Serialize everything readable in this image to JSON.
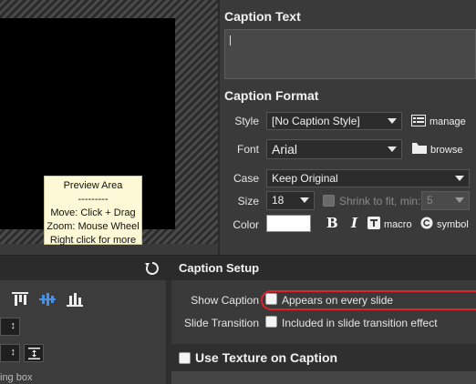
{
  "preview": {
    "tip_lines": [
      "Preview Area",
      "---------",
      "Move: Click + Drag",
      "Zoom: Mouse Wheel",
      "Right click for more"
    ]
  },
  "caption_text": {
    "title": "Caption Text",
    "value": ""
  },
  "caption_format": {
    "title": "Caption Format",
    "style_label": "Style",
    "style_value": "[No Caption Style]",
    "manage_label": "manage",
    "font_label": "Font",
    "font_value": "Arial",
    "browse_label": "browse",
    "case_label": "Case",
    "case_value": "Keep Original",
    "size_label": "Size",
    "size_value": "18",
    "shrink_label": "Shrink to fit, min:",
    "shrink_min": "5",
    "color_label": "Color",
    "color_value": "#ffffff",
    "macro_label": "macro",
    "symbol_label": "symbol"
  },
  "caption_setup": {
    "title": "Caption Setup",
    "show_caption_label": "Show Caption",
    "show_caption_option": "Appears on every slide",
    "slide_transition_label": "Slide Transition",
    "slide_transition_option": "Included in slide transition effect",
    "texture_label": "Use Texture on Caption"
  },
  "left_panel": {
    "truncated_label": "ing box"
  },
  "colors": {
    "highlight_outline": "#e0232b",
    "accent_blue": "#4a90e2"
  }
}
